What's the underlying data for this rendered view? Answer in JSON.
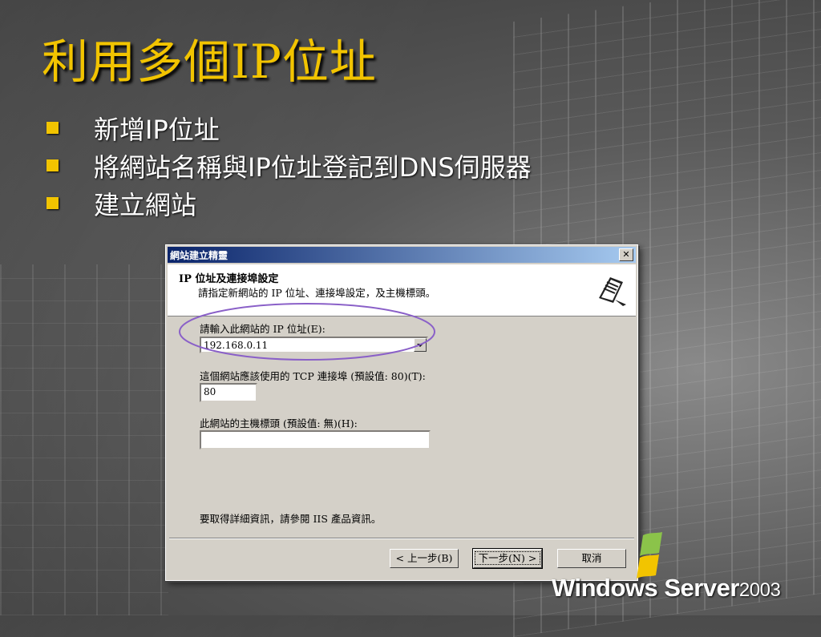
{
  "slide": {
    "title": "利用多個IP位址",
    "bullets": [
      {
        "text": "新增IP位址"
      },
      {
        "text": "將網站名稱與IP位址登記到DNS伺服器"
      },
      {
        "text": "建立網站"
      }
    ],
    "accent_color": "#f2c400"
  },
  "dialog": {
    "title": "網站建立精靈",
    "close_icon": "close-icon",
    "header_title": "IP 位址及連接埠設定",
    "header_subtitle": "請指定新網站的 IP 位址、連接埠設定，及主機標頭。",
    "ip_label": "請輸入此網站的 IP 位址(E):",
    "ip_value": "192.168.0.11",
    "port_label": "這個網站應該使用的 TCP 連接埠 (預設值: 80)(T):",
    "port_value": "80",
    "host_label": "此網站的主機標頭 (預設值: 無)(H):",
    "host_value": "",
    "info_text": "要取得詳細資訊，請參閱 IIS 產品資訊。",
    "back_button": "< 上一步(B)",
    "next_button": "下一步(N) >",
    "cancel_button": "取消",
    "highlight_color": "#8a60c8"
  },
  "logo": {
    "brand": "Windows Server",
    "year": "2003"
  }
}
